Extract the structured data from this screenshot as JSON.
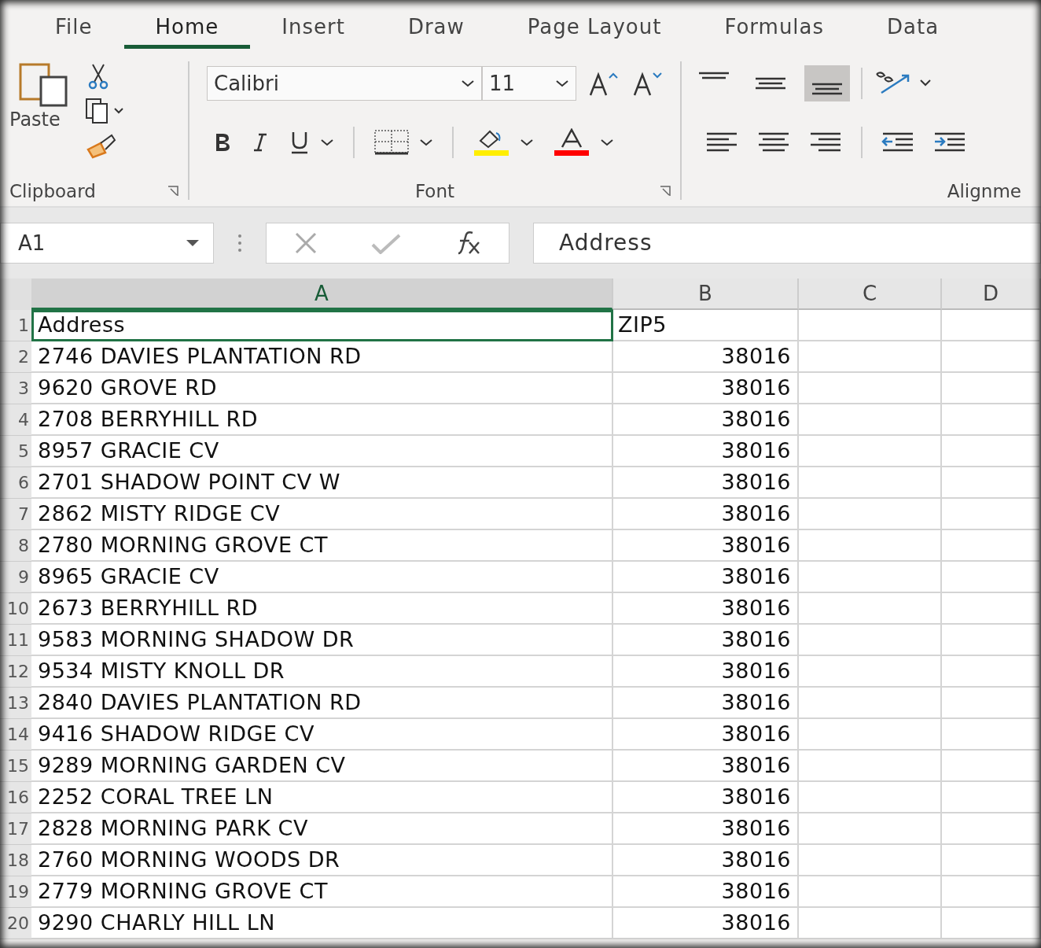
{
  "ribbon_tabs": [
    {
      "label": "File",
      "selected": false
    },
    {
      "label": "Home",
      "selected": true
    },
    {
      "label": "Insert",
      "selected": false
    },
    {
      "label": "Draw",
      "selected": false
    },
    {
      "label": "Page Layout",
      "selected": false
    },
    {
      "label": "Formulas",
      "selected": false
    },
    {
      "label": "Data",
      "selected": false
    }
  ],
  "clipboard": {
    "paste_label": "Paste",
    "group_label": "Clipboard"
  },
  "font": {
    "font_name": "Calibri",
    "font_size": "11",
    "group_label": "Font"
  },
  "alignment": {
    "vertical_buttons": [
      {
        "kind": "top",
        "selected": false
      },
      {
        "kind": "middle",
        "selected": false
      },
      {
        "kind": "bottom",
        "selected": true
      }
    ],
    "group_label": "Alignme"
  },
  "formula_bar": {
    "name_box": "A1",
    "value": "Address"
  },
  "columns": [
    {
      "label": "A",
      "selected": true
    },
    {
      "label": "B",
      "selected": false
    },
    {
      "label": "C",
      "selected": false
    },
    {
      "label": "D",
      "selected": false
    }
  ],
  "rows": [
    {
      "row_label": "1",
      "address": "Address",
      "zip": "ZIP5",
      "kind": "header",
      "selected": true
    },
    {
      "row_label": "2",
      "address": "2746 DAVIES PLANTATION RD",
      "zip": "38016",
      "kind": "data",
      "selected": false
    },
    {
      "row_label": "3",
      "address": "9620 GROVE RD",
      "zip": "38016",
      "kind": "data",
      "selected": false
    },
    {
      "row_label": "4",
      "address": "2708 BERRYHILL RD",
      "zip": "38016",
      "kind": "data",
      "selected": false
    },
    {
      "row_label": "5",
      "address": "8957 GRACIE CV",
      "zip": "38016",
      "kind": "data",
      "selected": false
    },
    {
      "row_label": "6",
      "address": "2701 SHADOW POINT CV W",
      "zip": "38016",
      "kind": "data",
      "selected": false
    },
    {
      "row_label": "7",
      "address": "2862 MISTY RIDGE CV",
      "zip": "38016",
      "kind": "data",
      "selected": false
    },
    {
      "row_label": "8",
      "address": "2780 MORNING GROVE CT",
      "zip": "38016",
      "kind": "data",
      "selected": false
    },
    {
      "row_label": "9",
      "address": "8965 GRACIE CV",
      "zip": "38016",
      "kind": "data",
      "selected": false
    },
    {
      "row_label": "10",
      "address": "2673 BERRYHILL RD",
      "zip": "38016",
      "kind": "data",
      "selected": false
    },
    {
      "row_label": "11",
      "address": "9583 MORNING SHADOW DR",
      "zip": "38016",
      "kind": "data",
      "selected": false
    },
    {
      "row_label": "12",
      "address": "9534 MISTY KNOLL DR",
      "zip": "38016",
      "kind": "data",
      "selected": false
    },
    {
      "row_label": "13",
      "address": "2840 DAVIES PLANTATION RD",
      "zip": "38016",
      "kind": "data",
      "selected": false
    },
    {
      "row_label": "14",
      "address": "9416 SHADOW RIDGE CV",
      "zip": "38016",
      "kind": "data",
      "selected": false
    },
    {
      "row_label": "15",
      "address": "9289 MORNING GARDEN CV",
      "zip": "38016",
      "kind": "data",
      "selected": false
    },
    {
      "row_label": "16",
      "address": "2252 CORAL TREE LN",
      "zip": "38016",
      "kind": "data",
      "selected": false
    },
    {
      "row_label": "17",
      "address": "2828 MORNING PARK CV",
      "zip": "38016",
      "kind": "data",
      "selected": false
    },
    {
      "row_label": "18",
      "address": "2760 MORNING WOODS DR",
      "zip": "38016",
      "kind": "data",
      "selected": false
    },
    {
      "row_label": "19",
      "address": "2779 MORNING GROVE CT",
      "zip": "38016",
      "kind": "data",
      "selected": false
    },
    {
      "row_label": "20",
      "address": "9290 CHARLY HILL LN",
      "zip": "38016",
      "kind": "data",
      "selected": false
    }
  ]
}
